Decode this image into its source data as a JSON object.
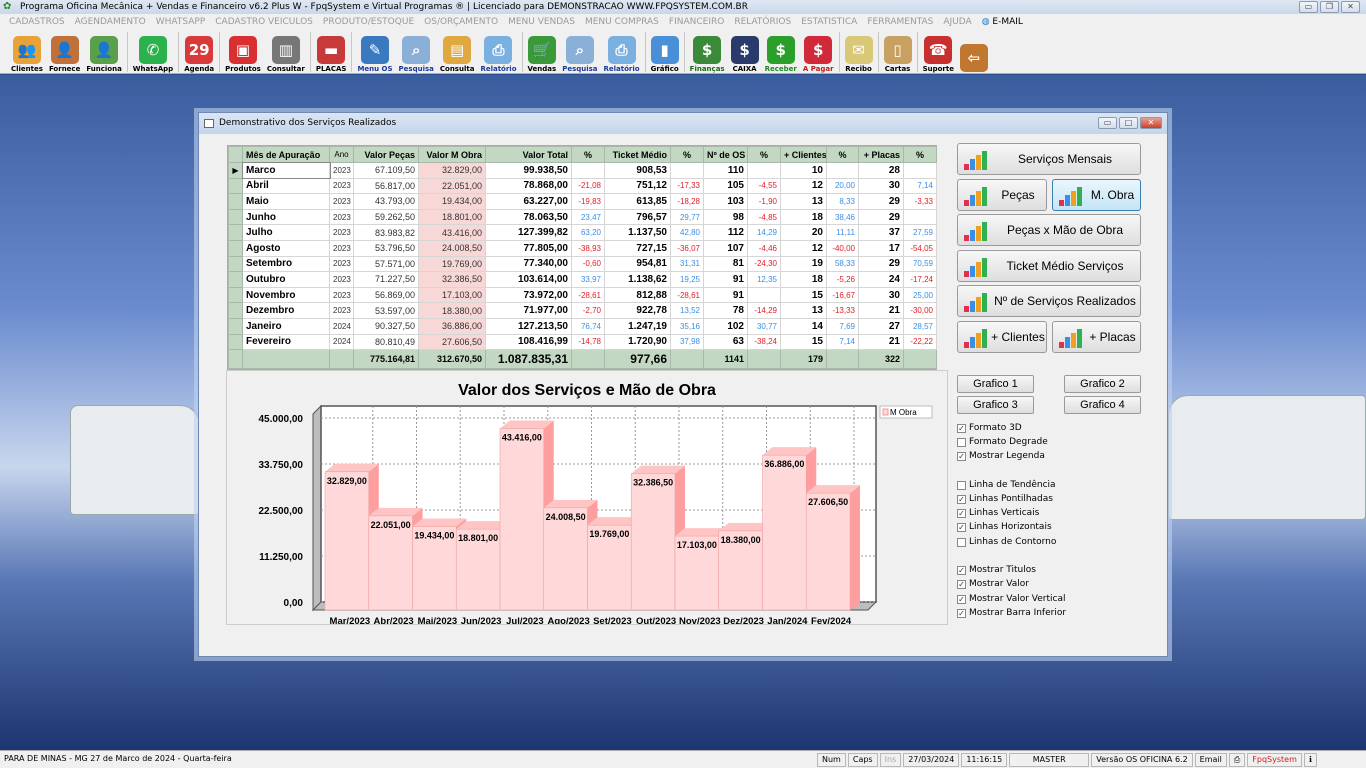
{
  "window": {
    "title": "Programa Oficina Mecânica + Vendas e Financeiro v6.2 Plus W - FpqSystem e Virtual Programas ® | Licenciado para  DEMONSTRACAO WWW.FPQSYSTEM.COM.BR"
  },
  "menu": [
    "CADASTROS",
    "AGENDAMENTO",
    "WHATSAPP",
    "CADASTRO VEICULOS",
    "PRODUTO/ESTOQUE",
    "OS/ORÇAMENTO",
    "MENU VENDAS",
    "MENU COMPRAS",
    "FINANCEIRO",
    "RELATÓRIOS",
    "ESTATISTICA",
    "FERRAMENTAS",
    "AJUDA"
  ],
  "menu_email": "E-MAIL",
  "toolbar": [
    {
      "label": "Clientes",
      "icon": "clients-icon",
      "color": "#e8a23a",
      "glyph": "👥",
      "sep": false
    },
    {
      "label": "Fornece",
      "icon": "supplier-icon",
      "color": "#c0703a",
      "glyph": "👤",
      "sep": false
    },
    {
      "label": "Funciona",
      "icon": "employee-icon",
      "color": "#5aa04a",
      "glyph": "👤",
      "sep": true
    },
    {
      "label": "WhatsApp",
      "icon": "whatsapp-icon",
      "color": "#2bb24c",
      "glyph": "✆",
      "sep": true
    },
    {
      "label": "Agenda",
      "icon": "calendar-icon",
      "color": "#d83a3a",
      "glyph": "29",
      "sep": true
    },
    {
      "label": "Produtos",
      "icon": "toolbox-icon",
      "color": "#d83030",
      "glyph": "▣",
      "sep": false
    },
    {
      "label": "Consultar",
      "icon": "barcode-icon",
      "color": "#777777",
      "glyph": "▥",
      "sep": true
    },
    {
      "label": "PLACAS",
      "icon": "truck-icon",
      "color": "#c83a3a",
      "glyph": "▬",
      "sep": true
    },
    {
      "label": "Menu OS",
      "icon": "clipboard-icon",
      "color": "#3a78c0",
      "glyph": "✎",
      "sep": false
    },
    {
      "label": "Pesquisa",
      "icon": "search-doc-icon",
      "color": "#8ab0d8",
      "glyph": "⌕",
      "sep": false
    },
    {
      "label": "Consulta",
      "icon": "drawer-icon",
      "color": "#e0a840",
      "glyph": "▤",
      "sep": false
    },
    {
      "label": "Relatório",
      "icon": "printer-icon",
      "color": "#7ab0e0",
      "glyph": "⎙",
      "sep": true
    },
    {
      "label": "Vendas",
      "icon": "cart-icon",
      "color": "#3a9a3a",
      "glyph": "🛒",
      "sep": false
    },
    {
      "label": "Pesquisa",
      "icon": "search-doc-icon",
      "color": "#8ab0d8",
      "glyph": "⌕",
      "sep": false
    },
    {
      "label": "Relatório",
      "icon": "printer-icon",
      "color": "#7ab0e0",
      "glyph": "⎙",
      "sep": true
    },
    {
      "label": "Gráfico",
      "icon": "chart-icon",
      "color": "#4a90d8",
      "glyph": "▮",
      "sep": true
    },
    {
      "label": "Finanças",
      "icon": "finance-icon",
      "color": "#3a8a3a",
      "glyph": "$",
      "sep": false
    },
    {
      "label": "CAIXA",
      "icon": "cashbook-icon",
      "color": "#2a3a6a",
      "glyph": "$",
      "sep": false
    },
    {
      "label": "Receber",
      "icon": "receive-icon",
      "color": "#2aa02a",
      "glyph": "$",
      "sep": false
    },
    {
      "label": "A Pagar",
      "icon": "pay-icon",
      "color": "#d02a3a",
      "glyph": "$",
      "sep": true
    },
    {
      "label": "Recibo",
      "icon": "receipt-icon",
      "color": "#d8c878",
      "glyph": "✉",
      "sep": true
    },
    {
      "label": "Cartas",
      "icon": "scroll-icon",
      "color": "#c8a060",
      "glyph": "▯",
      "sep": true
    },
    {
      "label": "Suporte",
      "icon": "support-icon",
      "color": "#c83030",
      "glyph": "☎",
      "sep": false
    },
    {
      "label": "",
      "icon": "exit-icon",
      "color": "#c07830",
      "glyph": "⇦",
      "sep": false
    }
  ],
  "dialog": {
    "title": "Demonstrativo dos Serviços Realizados"
  },
  "table": {
    "headers": [
      "Mês de Apuração",
      "Ano",
      "Valor Peças",
      "Valor M Obra",
      "Valor Total",
      "%",
      "Ticket Médio",
      "%",
      "Nº de OS",
      "%",
      "+ Clientes",
      "%",
      "+ Placas",
      "%"
    ],
    "rows": [
      [
        "Marco",
        "2023",
        "67.109,50",
        "32.829,00",
        "99.938,50",
        "",
        "908,53",
        "",
        "110",
        "",
        "10",
        "",
        "28",
        ""
      ],
      [
        "Abril",
        "2023",
        "56.817,00",
        "22.051,00",
        "78.868,00",
        "-21,08",
        "751,12",
        "-17,33",
        "105",
        "-4,55",
        "12",
        "20,00",
        "30",
        "7,14"
      ],
      [
        "Maio",
        "2023",
        "43.793,00",
        "19.434,00",
        "63.227,00",
        "-19,83",
        "613,85",
        "-18,28",
        "103",
        "-1,90",
        "13",
        "8,33",
        "29",
        "-3,33"
      ],
      [
        "Junho",
        "2023",
        "59.262,50",
        "18.801,00",
        "78.063,50",
        "23,47",
        "796,57",
        "29,77",
        "98",
        "-4,85",
        "18",
        "38,46",
        "29",
        ""
      ],
      [
        "Julho",
        "2023",
        "83.983,82",
        "43.416,00",
        "127.399,82",
        "63,20",
        "1.137,50",
        "42,80",
        "112",
        "14,29",
        "20",
        "11,11",
        "37",
        "27,59"
      ],
      [
        "Agosto",
        "2023",
        "53.796,50",
        "24.008,50",
        "77.805,00",
        "-38,93",
        "727,15",
        "-36,07",
        "107",
        "-4,46",
        "12",
        "-40,00",
        "17",
        "-54,05"
      ],
      [
        "Setembro",
        "2023",
        "57.571,00",
        "19.769,00",
        "77.340,00",
        "-0,60",
        "954,81",
        "31,31",
        "81",
        "-24,30",
        "19",
        "58,33",
        "29",
        "70,59"
      ],
      [
        "Outubro",
        "2023",
        "71.227,50",
        "32.386,50",
        "103.614,00",
        "33,97",
        "1.138,62",
        "19,25",
        "91",
        "12,35",
        "18",
        "-5,26",
        "24",
        "-17,24"
      ],
      [
        "Novembro",
        "2023",
        "56.869,00",
        "17.103,00",
        "73.972,00",
        "-28,61",
        "812,88",
        "-28,61",
        "91",
        "",
        "15",
        "-16,67",
        "30",
        "25,00"
      ],
      [
        "Dezembro",
        "2023",
        "53.597,00",
        "18.380,00",
        "71.977,00",
        "-2,70",
        "922,78",
        "13,52",
        "78",
        "-14,29",
        "13",
        "-13,33",
        "21",
        "-30,00"
      ],
      [
        "Janeiro",
        "2024",
        "90.327,50",
        "36.886,00",
        "127.213,50",
        "76,74",
        "1.247,19",
        "35,16",
        "102",
        "30,77",
        "14",
        "7,69",
        "27",
        "28,57"
      ],
      [
        "Fevereiro",
        "2024",
        "80.810,49",
        "27.606,50",
        "108.416,99",
        "-14,78",
        "1.720,90",
        "37,98",
        "63",
        "-38,24",
        "15",
        "7,14",
        "21",
        "-22,22"
      ]
    ],
    "footer": [
      "",
      "",
      "775.164,81",
      "312.670,50",
      "1.087.835,31",
      "",
      "977,66",
      "",
      "1141",
      "",
      "179",
      "",
      "322",
      ""
    ]
  },
  "chart_data": {
    "type": "bar",
    "title": "Valor dos Serviços e Mão de Obra",
    "categories": [
      "Mar/2023",
      "Abr/2023",
      "Mai/2023",
      "Jun/2023",
      "Jul/2023",
      "Ago/2023",
      "Set/2023",
      "Out/2023",
      "Nov/2023",
      "Dez/2023",
      "Jan/2024",
      "Fev/2024"
    ],
    "series": [
      {
        "name": "M Obra",
        "values": [
          32829.0,
          22051.0,
          19434.0,
          18801.0,
          43416.0,
          24008.5,
          19769.0,
          32386.5,
          17103.0,
          18380.0,
          36886.0,
          27606.5
        ]
      }
    ],
    "value_labels": [
      "32.829,00",
      "22.051,00",
      "19.434,00",
      "18.801,00",
      "43.416,00",
      "24.008,50",
      "19.769,00",
      "32.386,50",
      "17.103,00",
      "18.380,00",
      "36.886,00",
      "27.606,50"
    ],
    "yticks": [
      0,
      11250,
      22500,
      33750,
      45000
    ],
    "ytick_labels": [
      "0,00",
      "11.250,00",
      "22.500,00",
      "33.750,00",
      "45.000,00"
    ],
    "ylim": [
      0,
      45000
    ],
    "legend": "top-right",
    "grid": true,
    "colors": {
      "bar": "#ffd9d9",
      "side": "#ff9e9e"
    }
  },
  "panel": {
    "buttons": [
      {
        "label": "Serviços Mensais",
        "selected": false
      },
      {
        "label": "Peças",
        "selected": false
      },
      {
        "label": "M. Obra",
        "selected": true
      },
      {
        "label": "Peças x Mão de Obra",
        "selected": false
      },
      {
        "label": "Ticket Médio Serviços",
        "selected": false
      },
      {
        "label": "Nº de Serviços Realizados",
        "selected": false
      },
      {
        "label": "+ Clientes",
        "selected": false
      },
      {
        "label": "+ Placas",
        "selected": false
      }
    ],
    "graficos": [
      "Grafico 1",
      "Grafico 2",
      "Grafico 3",
      "Grafico 4"
    ],
    "options": [
      {
        "label": "Formato 3D",
        "checked": true
      },
      {
        "label": "Formato Degrade",
        "checked": false
      },
      {
        "label": "Mostrar Legenda",
        "checked": true
      },
      {
        "label": "Linha de Tendência",
        "checked": false
      },
      {
        "label": "Linhas Pontilhadas",
        "checked": true
      },
      {
        "label": "Linhas Verticais",
        "checked": true
      },
      {
        "label": "Linhas Horizontais",
        "checked": true
      },
      {
        "label": "Linhas de Contorno",
        "checked": false
      },
      {
        "label": "Mostrar Titulos",
        "checked": true
      },
      {
        "label": "Mostrar Valor",
        "checked": true
      },
      {
        "label": "Mostrar Valor Vertical",
        "checked": true
      },
      {
        "label": "Mostrar Barra Inferior",
        "checked": true
      }
    ]
  },
  "status": {
    "location": "PARA DE MINAS - MG 27 de Marco de 2024 - Quarta-feira",
    "num": "Num",
    "caps": "Caps",
    "ins": "Ins",
    "date": "27/03/2024",
    "time": "11:16:15",
    "user": "MASTER",
    "version": "Versão OS OFICINA 6.2",
    "email": "Email",
    "brand": "FpqSystem"
  }
}
